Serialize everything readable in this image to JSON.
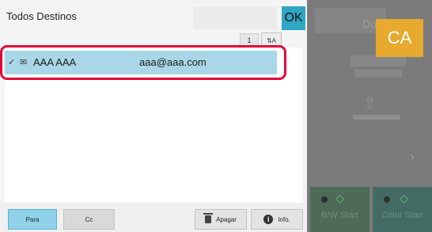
{
  "main_screen": {
    "ghost_label": "Do",
    "ca_label": "CA",
    "start_bw_label": "B/W Start",
    "start_color_label": "Color Start"
  },
  "dialog": {
    "title": "Todos Destinos",
    "ok_label": "OK",
    "page_number": "1",
    "sort_label": "⇅A",
    "list": [
      {
        "name": "AAA AAA",
        "email": "aaa@aaa.com",
        "selected": true,
        "icon": "mail-icon"
      }
    ]
  },
  "footer": {
    "para_label": "Para",
    "cc_label": "Cc",
    "apagar_label": "Apagar",
    "info_label": "Info."
  },
  "colors": {
    "ok": "#2fa6c3",
    "ca": "#e7a92e",
    "selected_row": "#a9d7e7",
    "highlight": "#e3063a",
    "para_active": "#8fd2ea"
  }
}
